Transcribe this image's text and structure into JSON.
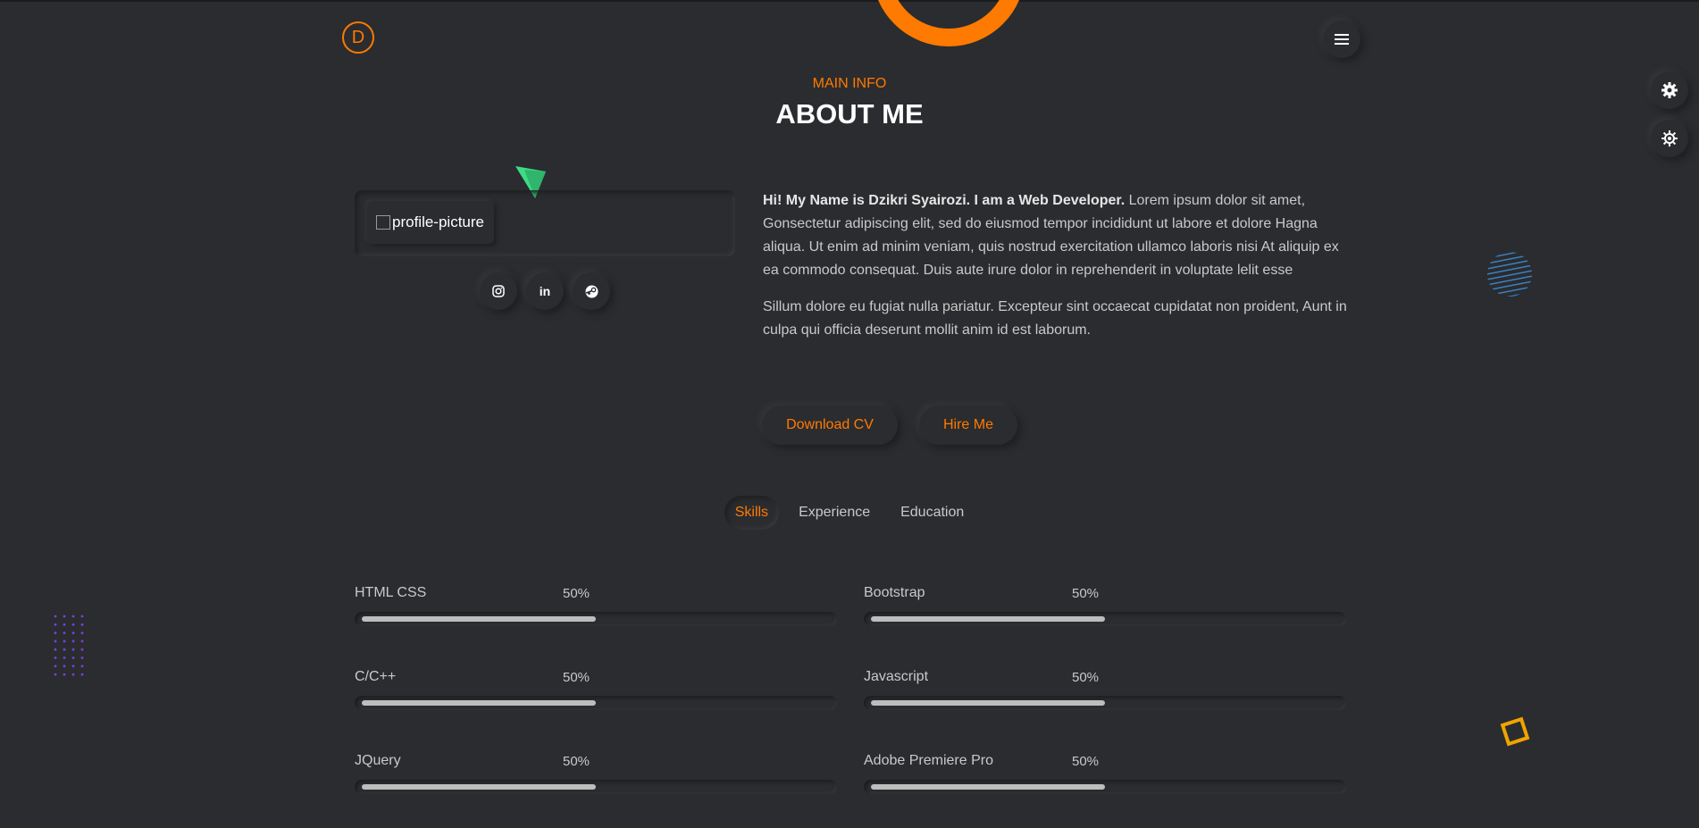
{
  "brand": {
    "logo_letter": "D",
    "accent": "#ff7a00"
  },
  "header": {
    "subtitle": "MAIN INFO",
    "title": "ABOUT ME"
  },
  "profile": {
    "image_alt": "profile-picture"
  },
  "social": [
    {
      "icon": "instagram-icon"
    },
    {
      "icon": "linkedin-icon",
      "glyph": "in"
    },
    {
      "icon": "steam-icon"
    }
  ],
  "about": {
    "intro_bold": "Hi! My Name is Dzikri Syairozi. I am a Web Developer.",
    "intro_rest": " Lorem ipsum dolor sit amet, Gonsectetur adipiscing elit, sed do eiusmod tempor incididunt ut labore et dolore Hagna aliqua. Ut enim ad minim veniam, quis nostrud exercitation ullamco laboris nisi At aliquip ex ea commodo consequat. Duis aute irure dolor in reprehenderit in voluptate lelit esse",
    "para2": "Sillum dolore eu fugiat nulla pariatur. Excepteur sint occaecat cupidatat non proident, Aunt in culpa qui officia deserunt mollit anim id est laborum."
  },
  "buttons": {
    "download_cv": "Download CV",
    "hire_me": "Hire Me"
  },
  "tabs": [
    {
      "label": "Skills",
      "active": true
    },
    {
      "label": "Experience",
      "active": false
    },
    {
      "label": "Education",
      "active": false
    }
  ],
  "skills": [
    {
      "name": "HTML CSS",
      "percent_label": "50%",
      "level": 0.5
    },
    {
      "name": "Bootstrap",
      "percent_label": "50%",
      "level": 0.5
    },
    {
      "name": "C/C++",
      "percent_label": "50%",
      "level": 0.5
    },
    {
      "name": "Javascript",
      "percent_label": "50%",
      "level": 0.5
    },
    {
      "name": "JQuery",
      "percent_label": "50%",
      "level": 0.5
    },
    {
      "name": "Adobe Premiere Pro",
      "percent_label": "50%",
      "level": 0.5
    }
  ],
  "icons": {
    "menu": "hamburger-menu-icon",
    "settings": "gear-icon",
    "theme": "sun-icon"
  },
  "colors": {
    "background": "#2b2c2f",
    "bar_fill": "#bdbdbd",
    "dots": "#7b3fe4",
    "stripes": "#3b82c4",
    "square": "#f0a400",
    "triangle": "#3ddc84"
  }
}
